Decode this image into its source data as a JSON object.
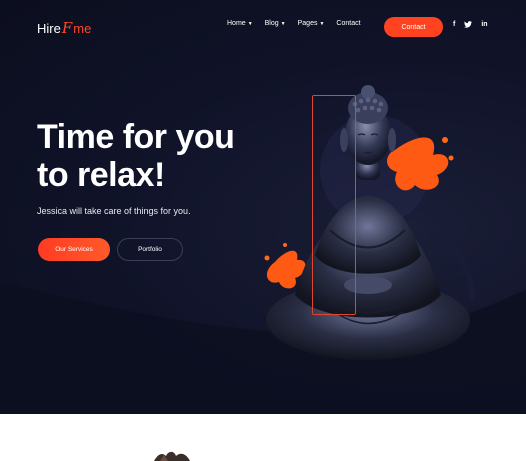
{
  "brand": {
    "hire": "Hire",
    "mark": "F",
    "me": "me"
  },
  "nav": {
    "items": [
      {
        "label": "Home",
        "dropdown": true
      },
      {
        "label": "Blog",
        "dropdown": true
      },
      {
        "label": "Pages",
        "dropdown": true
      },
      {
        "label": "Contact",
        "dropdown": false
      }
    ],
    "contact_button": "Contact",
    "social": [
      "f",
      "t",
      "in"
    ]
  },
  "hero": {
    "headline_line1": "Time for you",
    "headline_line2": "to relax!",
    "subtitle": "Jessica will take care of things for you.",
    "primary_button": "Our Services",
    "secondary_button": "Portfolio"
  },
  "colors": {
    "accent": "#ff4320",
    "background": "#0f1226",
    "text": "#ffffff"
  },
  "icons": {
    "social": [
      "facebook-icon",
      "twitter-icon",
      "linkedin-icon"
    ],
    "dropdown": "chevron-down-icon"
  }
}
